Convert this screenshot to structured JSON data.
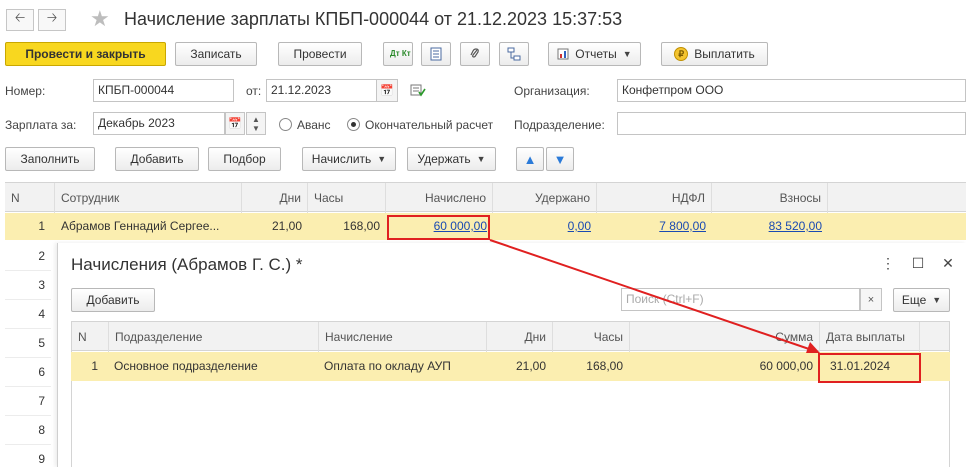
{
  "window": {
    "title": "Начисление зарплаты КПБП-000044 от 21.12.2023 15:37:53",
    "back_icon": "arrow-left-icon",
    "forward_icon": "arrow-right-icon",
    "favorite_icon": "star-icon"
  },
  "toolbar": {
    "post_close": "Провести и закрыть",
    "save": "Записать",
    "post": "Провести",
    "reports": "Отчеты",
    "pay": "Выплатить",
    "dt_kt_label": "Дт Кт"
  },
  "form": {
    "number_label": "Номер:",
    "number_value": "КПБП-000044",
    "date_label": "от:",
    "date_value": "21.12.2023",
    "org_label": "Организация:",
    "org_value": "Конфетпром ООО",
    "salary_label": "Зарплата за:",
    "salary_value": "Декабрь 2023",
    "advance_label": "Аванс",
    "final_label": "Окончательный расчет",
    "division_label": "Подразделение:",
    "division_value": ""
  },
  "actions": {
    "fill": "Заполнить",
    "add": "Добавить",
    "select": "Подбор",
    "accrue": "Начислить",
    "withhold": "Удержать"
  },
  "table": {
    "columns": [
      "N",
      "Сотрудник",
      "Дни",
      "Часы",
      "Начислено",
      "Удержано",
      "НДФЛ",
      "Взносы"
    ],
    "row": {
      "n": "1",
      "employee": "Абрамов Геннадий Сергее...",
      "days": "21,00",
      "hours": "168,00",
      "accrued": "60 000,00",
      "withheld": "0,00",
      "ndfl": "7 800,00",
      "contributions": "83 520,00"
    },
    "row_numbers": [
      "2",
      "3",
      "4",
      "5",
      "6",
      "7",
      "8",
      "9"
    ]
  },
  "subwindow": {
    "title": "Начисления (Абрамов Г. С.) *",
    "add": "Добавить",
    "search_placeholder": "Поиск (Ctrl+F)",
    "search_clear": "×",
    "more": "Еще",
    "columns": [
      "N",
      "Подразделение",
      "Начисление",
      "Дни",
      "Часы",
      "Сумма",
      "Дата выплаты"
    ],
    "row": {
      "n": "1",
      "division": "Основное подразделение",
      "accrual": "Оплата по окладу АУП",
      "days": "21,00",
      "hours": "168,00",
      "amount": "60 000,00",
      "pay_date": "31.01.2024"
    }
  },
  "colors": {
    "primary_button": "#f8d71f",
    "selected_row": "#fbeeb0",
    "link": "#1a4ab2",
    "highlight": "#e02020"
  }
}
